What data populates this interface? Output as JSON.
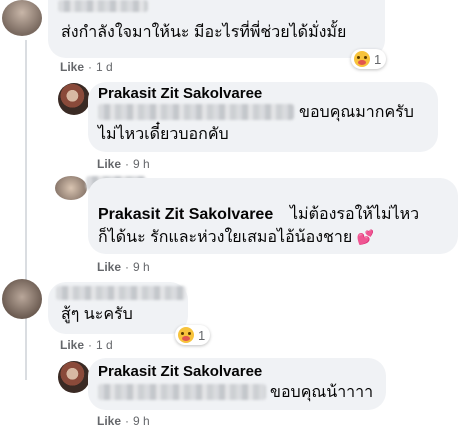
{
  "comments": [
    {
      "text": "ส่งกำลังใจมาให้นะ มีอะไรที่พี่ช่วยได้มั่งมั้ย",
      "like": "Like",
      "time": "1 d",
      "reaction_count": "1",
      "reaction_icon": "care-emoji-icon"
    },
    {
      "author": "Prakasit Zit Sakolvaree",
      "text_line1": "ขอบคุณมากครับ",
      "text_line2": "ไม่ไหวเดี๋ยวบอกคับ",
      "like": "Like",
      "time": "9 h"
    },
    {
      "author": "Prakasit Zit Sakolvaree",
      "text_line1": "ไม่ต้องรอให้ไม่ไหว",
      "text_line2": "ก็ได้นะ รักและห่วงใยเสมอไอ้น้องชาย",
      "emoji": "💕",
      "like": "Like",
      "time": "9 h"
    },
    {
      "text": "สู้ๆ นะครับ",
      "like": "Like",
      "time": "1 d",
      "reaction_count": "1",
      "reaction_icon": "care-emoji-icon"
    },
    {
      "author": "Prakasit Zit Sakolvaree",
      "text": "ขอบคุณน้าาาา",
      "like": "Like",
      "time": "9 h"
    }
  ],
  "separator": "·",
  "colors": {
    "bubble": "#f0f2f5",
    "meta": "#65676b",
    "text": "#050505"
  }
}
